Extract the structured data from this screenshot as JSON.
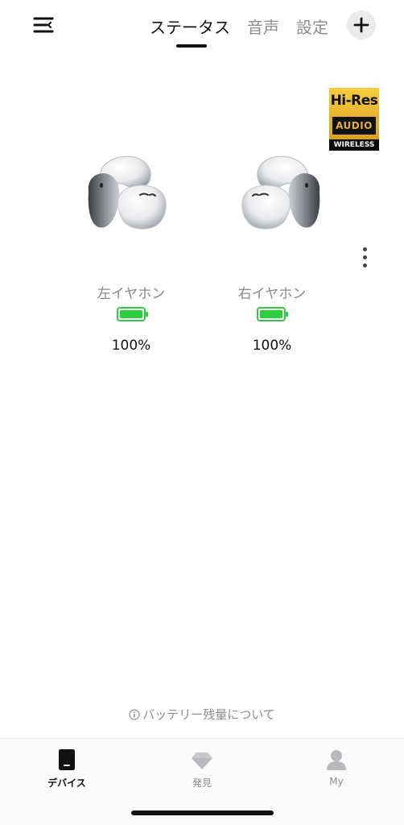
{
  "header": {
    "menu_icon": "menu-lines-icon",
    "tabs": [
      {
        "label": "ステータス",
        "active": true
      },
      {
        "label": "音声",
        "active": false
      },
      {
        "label": "設定",
        "active": false
      }
    ],
    "add_icon": "plus-icon"
  },
  "badge": {
    "line1": "Hi-Res",
    "line2": "AUDIO",
    "line3": "WIRELESS"
  },
  "more_icon": "vertical-dots-icon",
  "earbuds": {
    "left": {
      "label": "左イヤホン",
      "battery": "100%",
      "battery_level": 1.0
    },
    "right": {
      "label": "右イヤホン",
      "battery": "100%",
      "battery_level": 1.0
    }
  },
  "battery_info": {
    "icon": "info-circle-icon",
    "text": "バッテリー残量について"
  },
  "bottom_nav": [
    {
      "label": "デバイス",
      "icon": "device-icon",
      "active": true
    },
    {
      "label": "発見",
      "icon": "diamond-icon",
      "active": false
    },
    {
      "label": "My",
      "icon": "person-icon",
      "active": false
    }
  ],
  "colors": {
    "battery_green": "#2ecc40",
    "active_text": "#111111",
    "inactive_text": "#8e8e8e",
    "badge_gold": "#e6b12b"
  }
}
